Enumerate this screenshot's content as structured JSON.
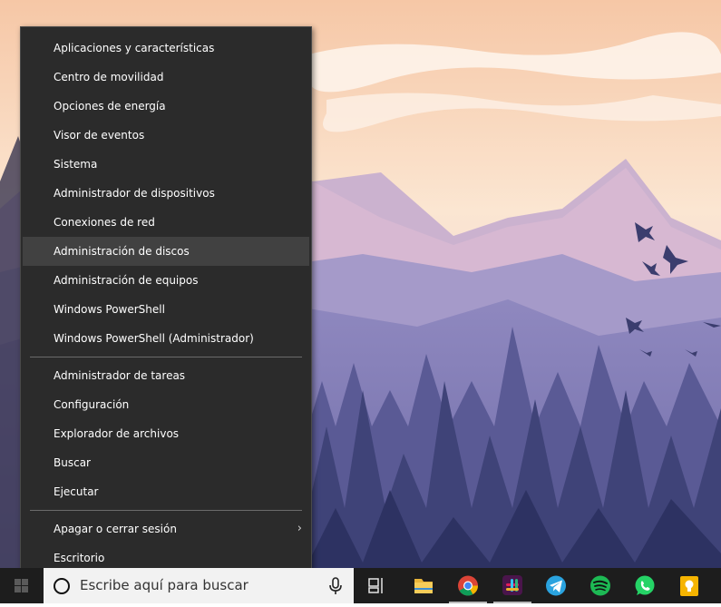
{
  "menu": {
    "groups": [
      [
        {
          "label": "Aplicaciones y características"
        },
        {
          "label": "Centro de movilidad"
        },
        {
          "label": "Opciones de energía"
        },
        {
          "label": "Visor de eventos"
        },
        {
          "label": "Sistema"
        },
        {
          "label": "Administrador de dispositivos"
        },
        {
          "label": "Conexiones de red"
        },
        {
          "label": "Administración de discos"
        },
        {
          "label": "Administración de equipos"
        },
        {
          "label": "Windows PowerShell"
        },
        {
          "label": "Windows PowerShell (Administrador)"
        }
      ],
      [
        {
          "label": "Administrador de tareas"
        },
        {
          "label": "Configuración"
        },
        {
          "label": "Explorador de archivos"
        },
        {
          "label": "Buscar"
        },
        {
          "label": "Ejecutar"
        }
      ],
      [
        {
          "label": "Apagar o cerrar sesión"
        },
        {
          "label": "Escritorio"
        }
      ]
    ],
    "hovered_item": "Administración de discos"
  },
  "taskbar": {
    "search_placeholder": "Escribe aquí para buscar",
    "icons": [
      "task-view-icon",
      "file-explorer-icon",
      "chrome-icon",
      "slack-icon",
      "telegram-icon",
      "spotify-icon",
      "whatsapp-icon",
      "keep-icon"
    ]
  },
  "colors": {
    "menu_bg": "#2b2b2b",
    "menu_hover": "#414141",
    "taskbar_bg": "#1d1d1d",
    "search_bg": "#f2f2f2"
  }
}
